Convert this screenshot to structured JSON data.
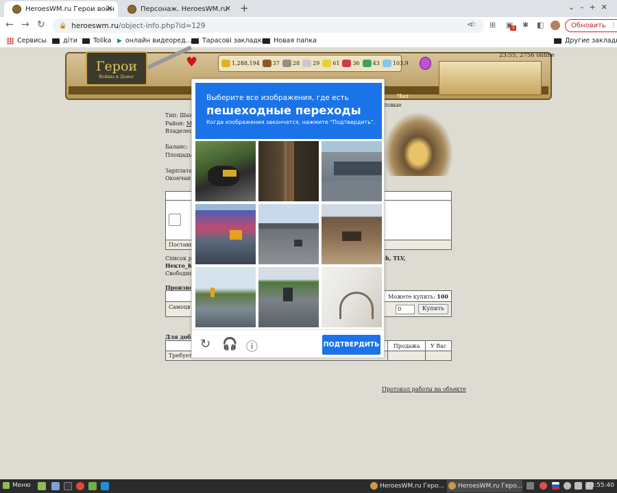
{
  "browser": {
    "tabs": [
      {
        "title": "HeroesWM.ru Герои войны и Деньги",
        "active": true
      },
      {
        "title": "Персонаж. HeroesWM.ru Герои войны",
        "active": false
      }
    ],
    "new_tab_icon": "plus-icon",
    "url_host": "heroeswm.ru",
    "url_path": "/object-info.php?id=129",
    "update_button": "Обновить",
    "update_menu_icon": "⋮",
    "extension_badge": "3"
  },
  "bookmarks": {
    "items": [
      "Сервисы",
      "діти",
      "Tolika",
      "онлайн видеоред...",
      "Тарасові закладки",
      "Новая папка"
    ],
    "other": "Другие закладки"
  },
  "game": {
    "logo_text": "Герои",
    "logo_sub": "Войны и Денег",
    "resources": [
      "1,288,194",
      "37",
      "28",
      "29",
      "61",
      "36",
      "43",
      "103,9"
    ],
    "online": "23:55, 2756 online",
    "menu_chat": "Чат",
    "info_lines": [
      "Тип: Шахт",
      "Район: ",
      "Владелец:",
      "",
      "Баланс:",
      "Площадь:",
      "",
      "Зарплата:",
      "Окончани"
    ],
    "district_link": "Mi",
    "info_right": "ловые",
    "table1": {
      "supplier_label": "Поставьте"
    },
    "workers": {
      "line1_prefix": "Список ра",
      "line1_suffix": "ych, TLV,",
      "line2": "Некто_К",
      "line3": "Свободны"
    },
    "section_prod": "Производ",
    "table2": {
      "can_buy_label": "Можете купить:",
      "can_buy_value": "100",
      "item_label": "Самоцв",
      "qty": "0",
      "buy_button": "Купить"
    },
    "section_mining": "Для добы",
    "table3": {
      "col_sale": "Продажа",
      "col_you": "У Вас",
      "row_label": "Требуется: шахт"
    },
    "protocol_link": "Протокол работы на объекте"
  },
  "captcha": {
    "line1": "Выберите все изображения, где есть",
    "line2": "пешеходные переходы",
    "line3": "Когда изображения закончатся, нажмите \"Подтвердить\".",
    "verify_button": "ПОДТВЕРДИТЬ",
    "icons": [
      "reload-icon",
      "headphones-icon",
      "info-icon"
    ]
  },
  "taskbar": {
    "menu_label": "Меню",
    "tasks": [
      "HeroesWM.ru Геро...",
      "HeroesWM.ru Геро..."
    ],
    "clock": "23:55:40"
  }
}
